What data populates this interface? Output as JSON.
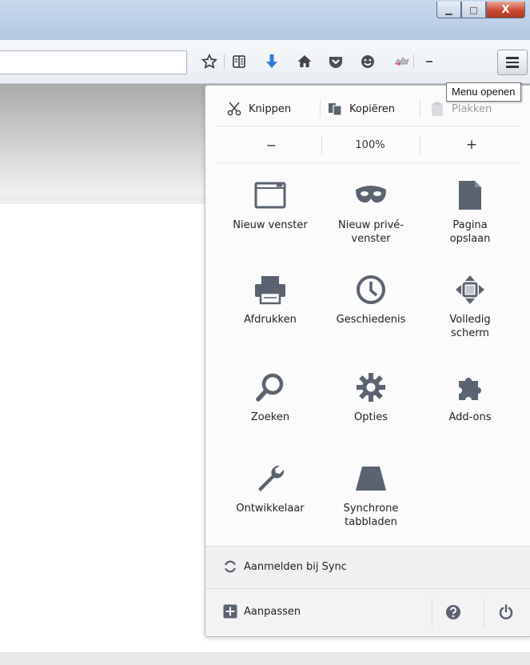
{
  "window": {
    "minimize_glyph": "▁",
    "maximize_glyph": "□",
    "close_glyph": "X"
  },
  "toolbar": {
    "icons": [
      "star-icon",
      "reading-list-icon",
      "download-icon",
      "home-icon",
      "pocket-icon",
      "chat-icon",
      "extension-icon",
      "dropdown-icon",
      "menu-icon"
    ]
  },
  "tooltip": {
    "text": "Menu openen"
  },
  "panel": {
    "edit": {
      "cut": "Knippen",
      "copy": "Kopiëren",
      "paste": "Plakken"
    },
    "zoom": {
      "out": "−",
      "level": "100%",
      "in": "+"
    },
    "items": [
      {
        "label": "Nieuw venster",
        "icon": "new-window-icon"
      },
      {
        "label": "Nieuw privé-\nvenster",
        "icon": "private-mask-icon"
      },
      {
        "label": "Pagina\nopslaan",
        "icon": "save-page-icon"
      },
      {
        "label": "Afdrukken",
        "icon": "printer-icon"
      },
      {
        "label": "Geschiedenis",
        "icon": "clock-icon"
      },
      {
        "label": "Volledig\nscherm",
        "icon": "fullscreen-icon"
      },
      {
        "label": "Zoeken",
        "icon": "search-icon"
      },
      {
        "label": "Opties",
        "icon": "gear-icon"
      },
      {
        "label": "Add-ons",
        "icon": "puzzle-icon"
      },
      {
        "label": "Ontwikkelaar",
        "icon": "wrench-icon"
      },
      {
        "label": "Synchrone\ntabbladen",
        "icon": "sync-tabs-icon"
      }
    ],
    "sync": {
      "label": "Aanmelden bij Sync"
    },
    "customize": {
      "label": "Aanpassen"
    }
  },
  "colors": {
    "icon_gray": "#5b6270",
    "accent_blue": "#2f7bd8"
  }
}
